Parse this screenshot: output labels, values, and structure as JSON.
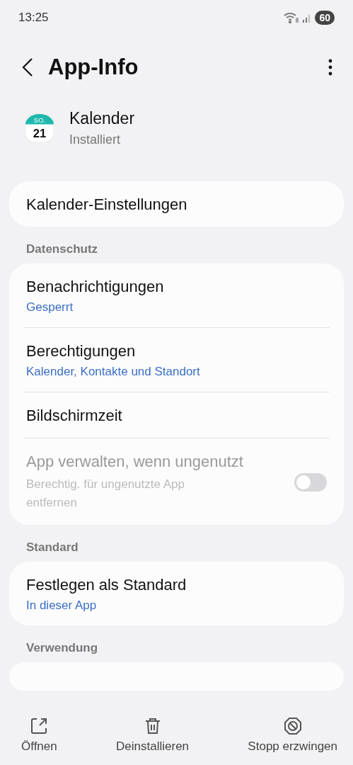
{
  "status_bar": {
    "time": "13:25",
    "battery": "60"
  },
  "header": {
    "title": "App-Info"
  },
  "app": {
    "name": "Kalender",
    "status": "Installiert",
    "icon_day": "SO.",
    "icon_date": "21"
  },
  "sections": [
    {
      "items": [
        {
          "kind": "plain",
          "title": "Kalender-Einstellungen"
        }
      ]
    },
    {
      "heading": "Datenschutz",
      "items": [
        {
          "kind": "plain",
          "title": "Benachrichtigungen",
          "subtitle": "Gesperrt"
        },
        {
          "kind": "plain",
          "title": "Berechtigungen",
          "subtitle": "Kalender, Kontakte und Standort"
        },
        {
          "kind": "plain",
          "title": "Bildschirmzeit"
        },
        {
          "kind": "toggle",
          "title": "App verwalten, wenn ungenutzt",
          "description": "Berechtig. für ungenutzte App entfernen",
          "on": false,
          "disabled": true
        }
      ]
    },
    {
      "heading": "Standard",
      "items": [
        {
          "kind": "plain",
          "title": "Festlegen als Standard",
          "subtitle": "In dieser App"
        }
      ]
    },
    {
      "heading": "Verwendung",
      "items": [
        {
          "kind": "cut"
        }
      ]
    }
  ],
  "bottom_actions": [
    {
      "kind": "open",
      "label": "Öffnen"
    },
    {
      "kind": "delete",
      "label": "Deinstallieren"
    },
    {
      "kind": "stop",
      "label": "Stopp erzwingen"
    }
  ]
}
